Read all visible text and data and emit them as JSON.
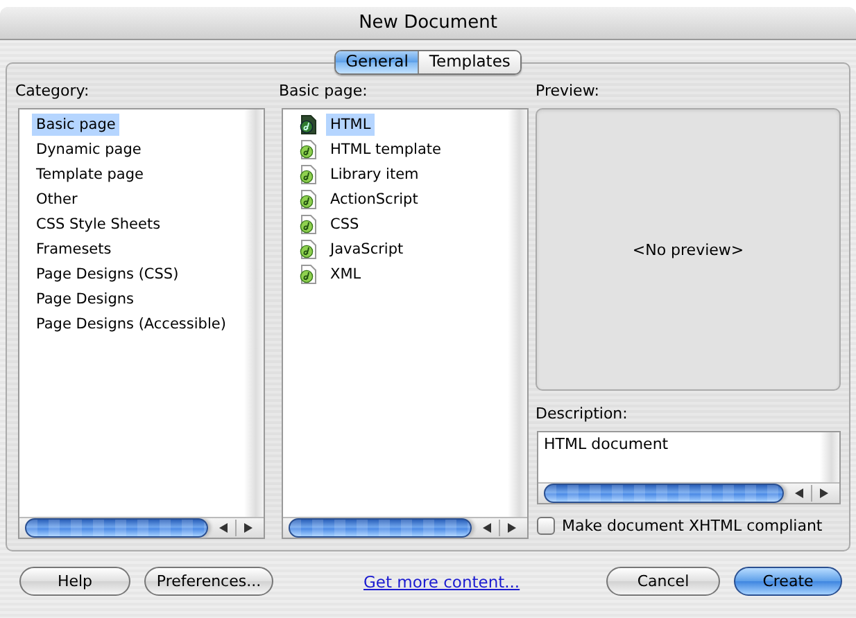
{
  "window": {
    "title": "New Document"
  },
  "tabs": [
    {
      "label": "General",
      "selected": true
    },
    {
      "label": "Templates",
      "selected": false
    }
  ],
  "category": {
    "label": "Category:",
    "items": [
      {
        "label": "Basic page",
        "selected": true
      },
      {
        "label": "Dynamic page",
        "selected": false
      },
      {
        "label": "Template page",
        "selected": false
      },
      {
        "label": "Other",
        "selected": false
      },
      {
        "label": "CSS Style Sheets",
        "selected": false
      },
      {
        "label": "Framesets",
        "selected": false
      },
      {
        "label": "Page Designs (CSS)",
        "selected": false
      },
      {
        "label": "Page Designs",
        "selected": false
      },
      {
        "label": "Page Designs (Accessible)",
        "selected": false
      }
    ]
  },
  "basic_page": {
    "label": "Basic page:",
    "items": [
      {
        "label": "HTML",
        "selected": true
      },
      {
        "label": "HTML template",
        "selected": false
      },
      {
        "label": "Library item",
        "selected": false
      },
      {
        "label": "ActionScript",
        "selected": false
      },
      {
        "label": "CSS",
        "selected": false
      },
      {
        "label": "JavaScript",
        "selected": false
      },
      {
        "label": "XML",
        "selected": false
      }
    ]
  },
  "preview": {
    "label": "Preview:",
    "text": "<No preview>"
  },
  "description": {
    "label": "Description:",
    "value": "HTML document"
  },
  "xhtml_compliant": {
    "label": "Make document XHTML compliant",
    "checked": false
  },
  "buttons": [
    {
      "label": "Help",
      "kind": "normal"
    },
    {
      "label": "Preferences...",
      "kind": "normal"
    },
    {
      "label": "Get more content...",
      "kind": "link"
    },
    {
      "label": "Cancel",
      "kind": "normal"
    },
    {
      "label": "Create",
      "kind": "default"
    }
  ]
}
